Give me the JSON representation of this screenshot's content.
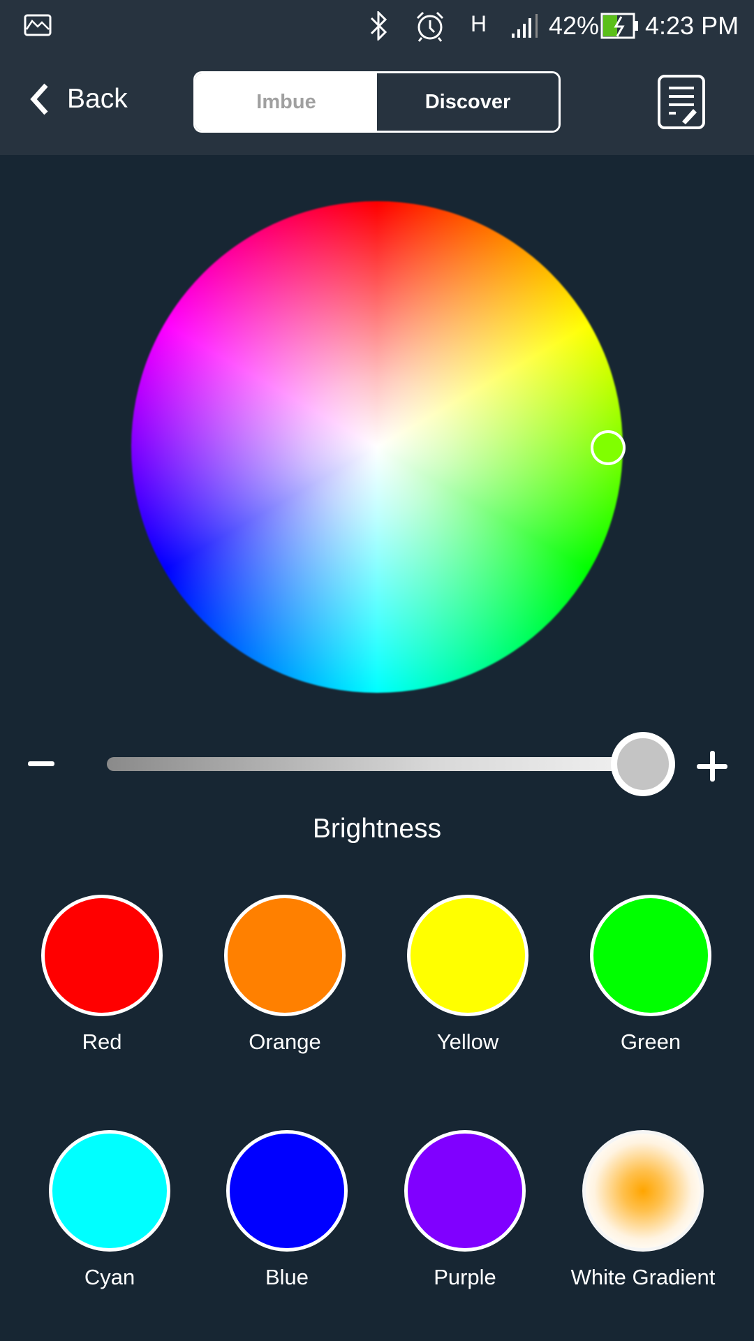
{
  "status_bar": {
    "battery": "42%",
    "time": "4:23 PM",
    "network": "H",
    "battery_color": "#5bbf1a",
    "icons": [
      "gallery-icon",
      "bluetooth-icon",
      "alarm-icon",
      "network-h-icon",
      "signal-icon",
      "battery-charging-icon"
    ]
  },
  "header": {
    "back_label": "Back",
    "tabs": [
      {
        "label": "Imbue",
        "selected": false
      },
      {
        "label": "Discover",
        "selected": true
      }
    ],
    "notes_icon": "notes-edit-icon"
  },
  "color_wheel": {
    "selected_color": "#80ff00"
  },
  "brightness": {
    "label": "Brightness",
    "value": 0.99,
    "minus_icon": "minus-icon",
    "plus_icon": "plus-icon"
  },
  "presets": [
    {
      "label": "Red",
      "color": "#ff0000"
    },
    {
      "label": "Orange",
      "color": "#ff8000"
    },
    {
      "label": "Yellow",
      "color": "#ffff00"
    },
    {
      "label": "Green",
      "color": "#00ff00"
    },
    {
      "label": "Cyan",
      "color": "#00ffff"
    },
    {
      "label": "Blue",
      "color": "#0000ff"
    },
    {
      "label": "Purple",
      "color": "#8000ff"
    },
    {
      "label": "White Gradient",
      "color": "radial-gradient(circle,#ffa500 0%,#ffc04d 25%,#fff3e0 60%,#ffffff 80%)"
    }
  ]
}
